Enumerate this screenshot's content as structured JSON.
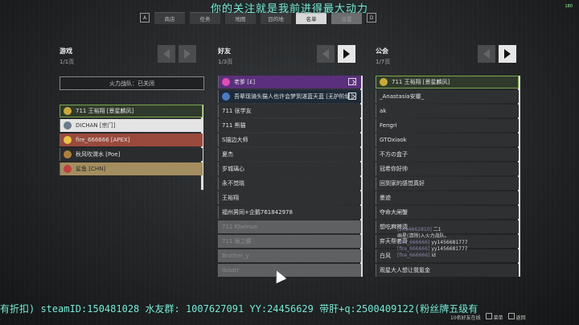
{
  "banner": "你的关注就是我前进得最大动力",
  "fps": "180",
  "nav": {
    "key_left": "A",
    "key_right": "D",
    "tabs": [
      {
        "label": "商店"
      },
      {
        "label": "任务"
      },
      {
        "label": "地图"
      },
      {
        "label": "目的地"
      },
      {
        "label": "名单"
      },
      {
        "label": "设置"
      }
    ]
  },
  "games": {
    "title": "游戏",
    "page": "1/1页",
    "fireteam_button": "火力战队：已关闭",
    "rows": [
      {
        "name": "711 王裕翔 [景星麟凤]",
        "style": "green",
        "icon_color": "#c9a93a"
      },
      {
        "name": "DICHAN [宗门] ",
        "style": "white",
        "icon_color": "#6b7b8c"
      },
      {
        "name": "fire_666666 [APEX]",
        "style": "red",
        "icon_color": "#e8c34a"
      },
      {
        "name": "秋风吹渭水 [Poe]",
        "style": "plain",
        "icon_color": "#b0803a"
      },
      {
        "name": "鲨鱼 [CHN]",
        "style": "tan",
        "icon_color": "#c04040"
      }
    ]
  },
  "friends": {
    "title": "好友",
    "page": "1/3页",
    "rows": [
      {
        "name": "老爹 [£]",
        "style": "purple",
        "icon_color": "#e04cb4"
      },
      {
        "name": "吾辈现骑头猫人也许会梦到湛蓝天蓝 [无护阶级]",
        "style": "dark",
        "icon_color": "#4a7cc0"
      },
      {
        "name": "711 张学友",
        "style": "normal"
      },
      {
        "name": "711 熊猫",
        "style": "normal"
      },
      {
        "name": "S描边大师",
        "style": "normal"
      },
      {
        "name": "夏杰",
        "style": "normal"
      },
      {
        "name": "岁城璃心",
        "style": "normal"
      },
      {
        "name": "永不觉晓",
        "style": "normal"
      },
      {
        "name": "王裕翔",
        "style": "normal"
      },
      {
        "name": "福州男同+企鹅761842978",
        "style": "normal"
      },
      {
        "name": "711 Kbelnue",
        "style": "faded"
      },
      {
        "name": "711 猴之腰",
        "style": "faded"
      },
      {
        "name": "Brother_y",
        "style": "faded"
      },
      {
        "name": "Ibisstr",
        "style": "faded"
      }
    ]
  },
  "clan": {
    "title": "公会",
    "page": "1/7页",
    "rows": [
      {
        "name": "711 王裕翔 [景星麟凤]",
        "style": "green",
        "icon_color": "#c9a93a"
      },
      {
        "name": "_Anastasia安娜_",
        "style": "normal"
      },
      {
        "name": "ak",
        "style": "normal"
      },
      {
        "name": "Fengri",
        "style": "normal"
      },
      {
        "name": "GTOxiaok",
        "style": "normal"
      },
      {
        "name": "不方の盒子",
        "style": "normal"
      },
      {
        "name": "冠希你好帅",
        "style": "normal"
      },
      {
        "name": "回到家的感觉真好",
        "style": "normal"
      },
      {
        "name": "墨迹",
        "style": "normal"
      },
      {
        "name": "夺命大闸蟹",
        "style": "normal"
      },
      {
        "name": "想吃麻辣烫",
        "style": "normal"
      },
      {
        "name": "弈天帮老哥",
        "style": "normal"
      },
      {
        "name": "白风",
        "style": "normal"
      },
      {
        "name": "观星大人想让我氪金",
        "style": "normal"
      }
    ]
  },
  "chat": [
    {
      "name": "[2094662810]",
      "text": "二1"
    },
    {
      "name": "",
      "text": "画星(清除)入火力战队。"
    },
    {
      "name": "[fire_666666]",
      "text": "yy1456681777"
    },
    {
      "name": "[fire_666666]",
      "text": "yy1456681777"
    },
    {
      "name": "[fire_666666]",
      "text": "id"
    }
  ],
  "ad_text": "有折扣) steamID:150481028  水友群: 1007627091  YY:24456629  带肝+q:2500409122(粉丝牌五级有",
  "footer": {
    "online": "10名好友在线",
    "menu": "菜单",
    "back": "返回"
  }
}
